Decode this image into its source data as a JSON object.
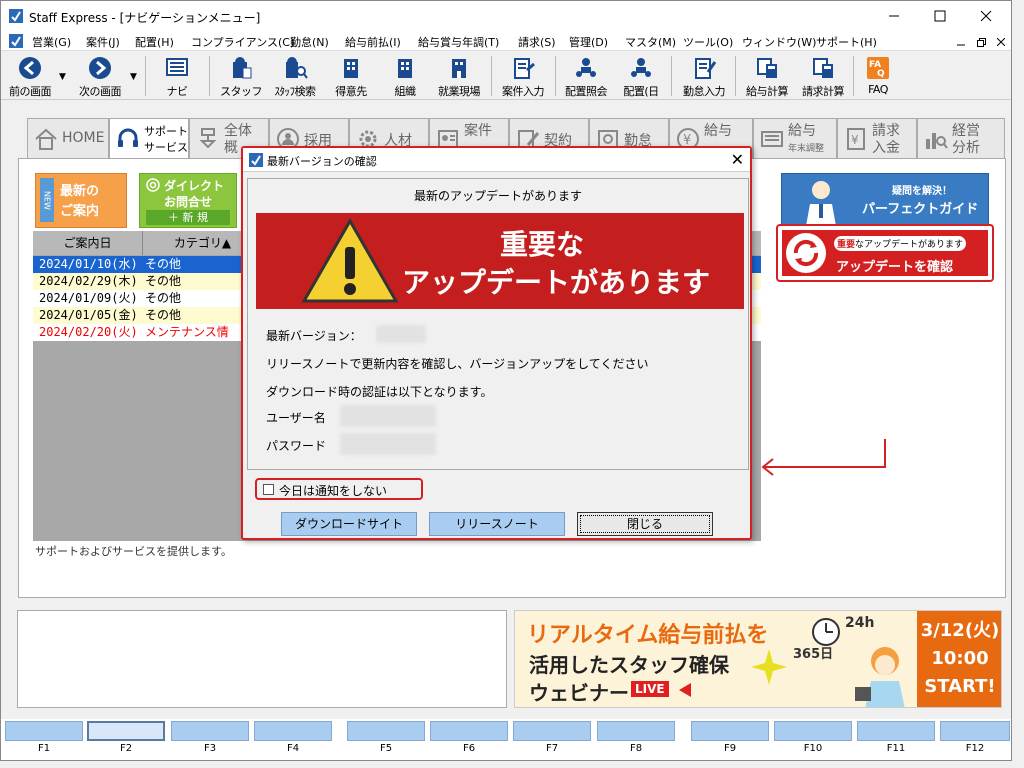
{
  "window": {
    "title": "Staff Express - [ナビゲーションメニュー]"
  },
  "menu": [
    "営業(G)",
    "案件(J)",
    "配置(H)",
    "コンプライアンス(C)",
    "勤怠(N)",
    "給与前払(I)",
    "給与賞与年調(T)",
    "請求(S)",
    "管理(D)",
    "マスタ(M)",
    "ツール(O)",
    "ウィンドウ(W)",
    "サポート(H)"
  ],
  "toolbar": [
    "前の画面",
    "次の画面",
    "ナビ",
    "スタッフ",
    "ｽﾀｯﾌ検索",
    "得意先",
    "組織",
    "就業現場",
    "案件入力",
    "配置照会",
    "配置(日",
    "勤怠入力",
    "給与計算",
    "請求計算",
    "FAQ"
  ],
  "tabs": [
    {
      "l1": "HOME",
      "l2": ""
    },
    {
      "l1": "サポート",
      "l2": "サービス"
    },
    {
      "l1": "全体",
      "l2": "概"
    },
    {
      "l1": "採用",
      "l2": ""
    },
    {
      "l1": "人材",
      "l2": ""
    },
    {
      "l1": "案件",
      "l2": ""
    },
    {
      "l1": "契約",
      "l2": ""
    },
    {
      "l1": "勤怠",
      "l2": ""
    },
    {
      "l1": "給与",
      "l2": ""
    },
    {
      "l1": "給与",
      "l2": "年末調整"
    },
    {
      "l1": "請求",
      "l2": "入金"
    },
    {
      "l1": "経営",
      "l2": "分析"
    }
  ],
  "left_buttons": {
    "news_tag": "NEW",
    "news_l1": "最新の",
    "news_l2": "ご案内",
    "direct_l1": "ダイレクト",
    "direct_l2": "お問合せ",
    "direct_new": "＋ 新 規"
  },
  "table": {
    "headers": [
      "ご案内日",
      "カテゴリ▲"
    ],
    "rows": [
      {
        "date": "2024/01/10(水)",
        "cat": "その他",
        "style": "sel"
      },
      {
        "date": "2024/02/29(木)",
        "cat": "その他",
        "style": "y"
      },
      {
        "date": "2024/01/09(火)",
        "cat": "その他",
        "style": ""
      },
      {
        "date": "2024/01/05(金)",
        "cat": "その他",
        "style": "y"
      },
      {
        "date": "2024/02/20(火)",
        "cat": "メンテナンス情",
        "style": "red"
      }
    ]
  },
  "status_line": "サポートおよびサービスを提供します。",
  "right_banner": {
    "l1": "疑問を解決！",
    "l2": "パーフェクトガイド"
  },
  "update_banner": {
    "badge_strong": "重要",
    "badge_rest": "なアップデートがあります",
    "cta": "アップデートを確認"
  },
  "webinar": {
    "l1": "リアルタイム給与前払を",
    "l2": "活用したスタッフ確保",
    "l3": "ウェビナー",
    "live": "LIVE",
    "d1": "3/12(火)",
    "d2": "10:00",
    "d3": "START!",
    "h": "24h",
    "days": "365日"
  },
  "fkeys": [
    "F1",
    "F2",
    "F3",
    "F4",
    "F5",
    "F6",
    "F7",
    "F8",
    "F9",
    "F10",
    "F11",
    "F12"
  ],
  "dialog": {
    "title": "最新バージョンの確認",
    "heading": "最新のアップデートがあります",
    "banner_l1": "重要な",
    "banner_l2": "アップデートがあります",
    "version_label": "最新バージョン：",
    "line1": "リリースノートで更新内容を確認し、バージョンアップをしてください",
    "line2": "ダウンロード時の認証は以下となります。",
    "user_label": "ユーザー名",
    "pass_label": "パスワード",
    "checkbox_label": "今日は通知をしない",
    "btn_download": "ダウンロードサイト",
    "btn_release": "リリースノート",
    "btn_close": "閉じる"
  },
  "colors": {
    "accent_red": "#d42020",
    "selection_blue": "#1a64d0",
    "fkey_blue": "#a8cdf0"
  }
}
